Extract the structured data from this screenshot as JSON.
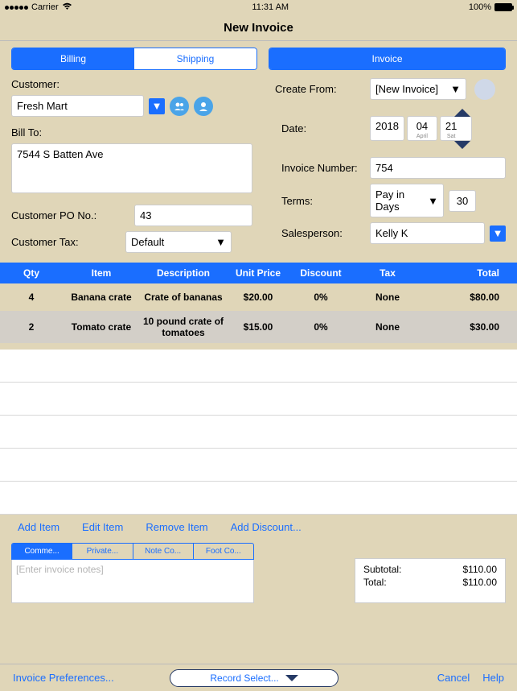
{
  "status": {
    "carrier": "Carrier",
    "time": "11:31 AM",
    "battery": "100%"
  },
  "title": "New Invoice",
  "tabs": {
    "billing": "Billing",
    "shipping": "Shipping",
    "invoice": "Invoice"
  },
  "left": {
    "customer_label": "Customer:",
    "customer_value": "Fresh Mart",
    "billto_label": "Bill To:",
    "billto_value": "7544 S Batten Ave",
    "po_label": "Customer PO No.:",
    "po_value": "43",
    "tax_label": "Customer Tax:",
    "tax_value": "Default"
  },
  "right": {
    "createfrom_label": "Create From:",
    "createfrom_value": "[New Invoice]",
    "date_label": "Date:",
    "date_year": "2018",
    "date_month": "04",
    "date_month_sub": "April",
    "date_day": "21",
    "date_day_sub": "Sat",
    "invno_label": "Invoice Number:",
    "invno_value": "754",
    "terms_label": "Terms:",
    "terms_value": "Pay in Days",
    "terms_days": "30",
    "sales_label": "Salesperson:",
    "sales_value": "Kelly K"
  },
  "table": {
    "headers": {
      "qty": "Qty",
      "item": "Item",
      "desc": "Description",
      "price": "Unit Price",
      "disc": "Discount",
      "tax": "Tax",
      "total": "Total"
    },
    "rows": [
      {
        "qty": "4",
        "item": "Banana crate",
        "desc": "Crate of bananas",
        "price": "$20.00",
        "disc": "0%",
        "tax": "None",
        "total": "$80.00"
      },
      {
        "qty": "2",
        "item": "Tomato crate",
        "desc": "10 pound crate of tomatoes",
        "price": "$15.00",
        "disc": "0%",
        "tax": "None",
        "total": "$30.00"
      }
    ]
  },
  "actions": {
    "add": "Add Item",
    "edit": "Edit Item",
    "remove": "Remove Item",
    "discount": "Add Discount..."
  },
  "notes": {
    "tabs": {
      "t1": "Comme...",
      "t2": "Private...",
      "t3": "Note Co...",
      "t4": "Foot Co..."
    },
    "placeholder": "[Enter invoice notes]"
  },
  "totals": {
    "subtotal_label": "Subtotal:",
    "subtotal_value": "$110.00",
    "total_label": "Total:",
    "total_value": "$110.00"
  },
  "footer": {
    "prefs": "Invoice Preferences...",
    "record": "Record Select...",
    "cancel": "Cancel",
    "help": "Help"
  }
}
